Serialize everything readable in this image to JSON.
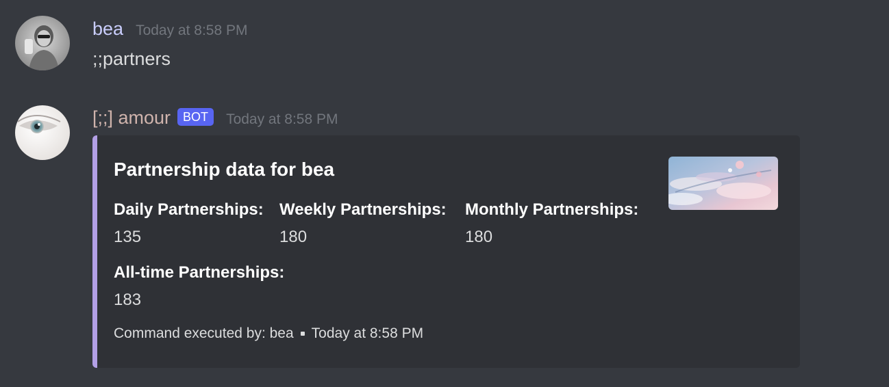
{
  "messages": [
    {
      "username": "bea",
      "username_color": "#c9cdfb",
      "timestamp": "Today at 8:58 PM",
      "content": ";;partners"
    },
    {
      "username": "[;;] amour",
      "username_color": "#d0b4ad",
      "bot_tag": "BOT",
      "timestamp": "Today at 8:58 PM",
      "embed": {
        "accent_color": "#b3a0e6",
        "title": "Partnership data for bea",
        "fields": [
          {
            "name": "Daily Partnerships:",
            "value": "135"
          },
          {
            "name": "Weekly Partnerships:",
            "value": "180"
          },
          {
            "name": "Monthly Partnerships:",
            "value": "180"
          },
          {
            "name": "All-time Partnerships:",
            "value": "183"
          }
        ],
        "footer": {
          "text": "Command executed by: bea",
          "timestamp": "Today at 8:58 PM"
        }
      }
    }
  ]
}
